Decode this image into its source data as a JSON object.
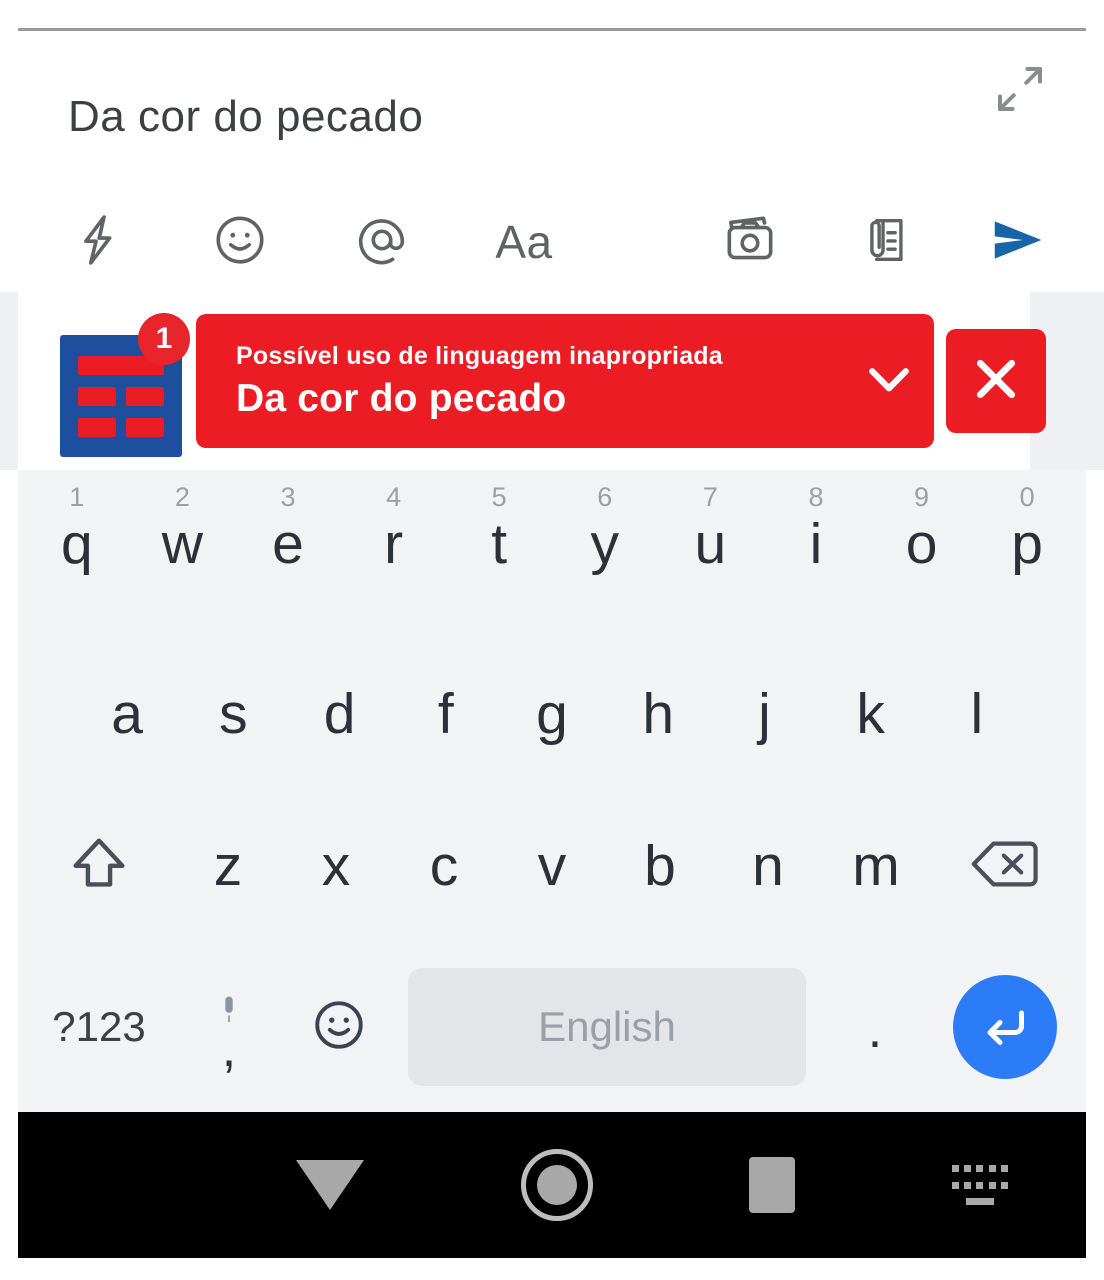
{
  "compose": {
    "input_value": "Da cor do pecado",
    "input_placeholder": "",
    "expand_icon": "expand-arrows-icon"
  },
  "toolbar": {
    "left_items": [
      {
        "name": "lightning-bolt-icon",
        "label": ""
      },
      {
        "name": "emoji-smiley-icon",
        "label": ""
      },
      {
        "name": "mention-at-icon",
        "label": ""
      },
      {
        "name": "format-text-icon",
        "label": "Aa"
      }
    ],
    "right_items": [
      {
        "name": "camera-icon",
        "label": ""
      },
      {
        "name": "attachment-document-icon",
        "label": ""
      },
      {
        "name": "send-icon",
        "label": ""
      }
    ],
    "send_color": "#1565a8"
  },
  "notification": {
    "app_icon_name": "news-app-icon",
    "app_icon_bg": "#1d4f9e",
    "app_icon_accent": "#ec1c24",
    "badge_count": "1",
    "banner_color": "#ec1c24",
    "title": "Possível uso de linguagem inapropriada",
    "subtitle": "Da cor do pecado",
    "expand_icon": "chevron-down-icon",
    "close_icon": "close-x-icon"
  },
  "keyboard": {
    "row1": [
      {
        "num": "1",
        "letter": "q"
      },
      {
        "num": "2",
        "letter": "w"
      },
      {
        "num": "3",
        "letter": "e"
      },
      {
        "num": "4",
        "letter": "r"
      },
      {
        "num": "5",
        "letter": "t"
      },
      {
        "num": "6",
        "letter": "y"
      },
      {
        "num": "7",
        "letter": "u"
      },
      {
        "num": "8",
        "letter": "i"
      },
      {
        "num": "9",
        "letter": "o"
      },
      {
        "num": "0",
        "letter": "p"
      }
    ],
    "row2": [
      "a",
      "s",
      "d",
      "f",
      "g",
      "h",
      "j",
      "k",
      "l"
    ],
    "row3": [
      "z",
      "x",
      "c",
      "v",
      "b",
      "n",
      "m"
    ],
    "shift_icon": "shift-arrow-icon",
    "backspace_icon": "backspace-icon",
    "symbols_key": "?123",
    "comma_key": ",",
    "mic_icon": "microphone-icon",
    "emoji_icon": "emoji-smiley-icon",
    "space_label": "English",
    "period_key": ".",
    "enter_icon": "enter-return-icon",
    "enter_color": "#2b7cf6"
  },
  "navbar": {
    "back_icon": "hide-keyboard-triangle-icon",
    "home_icon": "home-circle-icon",
    "recents_icon": "recents-square-icon",
    "switch_keyboard_icon": "keyboard-switch-icon"
  }
}
